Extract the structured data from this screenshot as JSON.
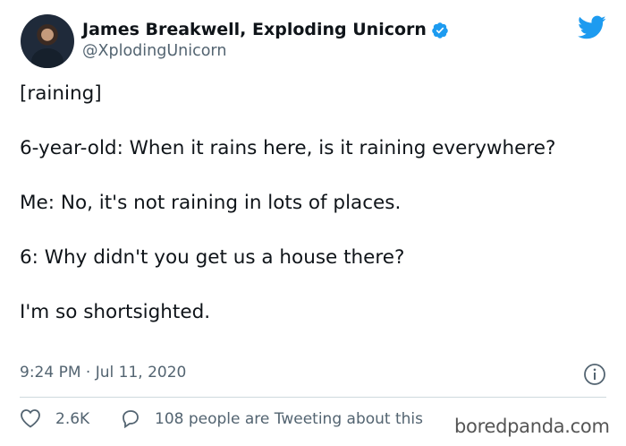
{
  "author": {
    "name": "James Breakwell, Exploding Unicorn",
    "handle": "@XplodingUnicorn"
  },
  "icons": {
    "verified": "verified-badge-icon",
    "brand": "twitter-bird-icon",
    "info": "info-icon",
    "like": "heart-icon",
    "reply": "speech-bubble-icon"
  },
  "colors": {
    "brand_blue": "#1d9bf0",
    "text": "#0f1419",
    "muted": "#536471",
    "divider": "#cfd9de"
  },
  "tweet": {
    "paragraphs": [
      "[raining]",
      "6-year-old: When it rains here, is it raining everywhere?",
      "Me: No, it's not raining in lots of places.",
      "6: Why didn't you get us a house there?",
      "I'm so shortsighted."
    ],
    "timestamp": "9:24 PM · Jul 11, 2020"
  },
  "actions": {
    "likes": "2.6K",
    "tweeting": "108 people are Tweeting about this"
  },
  "watermark": "boredpanda.com"
}
